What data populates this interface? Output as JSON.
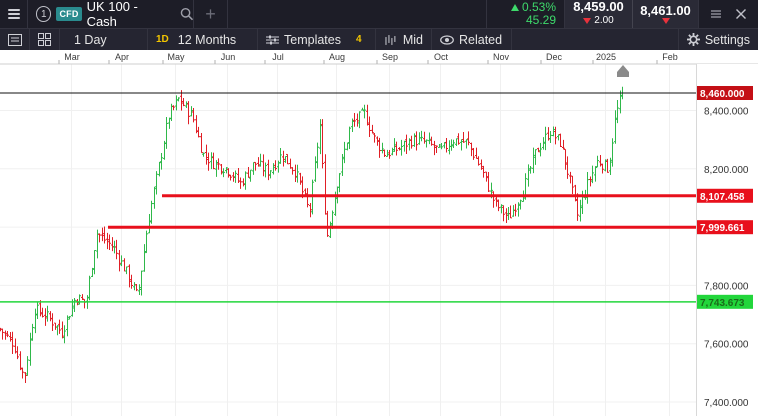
{
  "topbar": {
    "info_number": "1",
    "instrument_type": "CFD",
    "instrument_name": "UK 100 - Cash",
    "change_pct": "0.53%",
    "change_abs": "45.29",
    "sell_price": "8,459.00",
    "spread": "2.00",
    "buy_price": "8,461.00"
  },
  "toolbar": {
    "interval_label": "1 Day",
    "interval_badge": "1D",
    "range_label": "12 Months",
    "templates_label": "Templates",
    "templates_count": "4",
    "price_type_label": "Mid",
    "related_label": "Related",
    "settings_label": "Settings"
  },
  "colors": {
    "up": "#2fb84a",
    "down": "#e01f26",
    "support": "#e8101c",
    "green_level": "#22d63b",
    "current_tag": "#c40f16"
  },
  "chart_data": {
    "type": "ohlc",
    "x_labels": [
      "Mar",
      "Apr",
      "May",
      "Jun",
      "Jul",
      "Aug",
      "Sep",
      "Oct",
      "Nov",
      "Dec",
      "2025",
      "Feb"
    ],
    "y_ticks": [
      7400,
      7600,
      7800,
      8000,
      8200,
      8400
    ],
    "y_tick_labels": [
      "7,400.000",
      "7,600.000",
      "7,800.000",
      "8,000.000",
      "8,200.000",
      "8,400.000"
    ],
    "ylim": [
      7380,
      8500
    ],
    "current_price": 8460,
    "current_price_label": "8,460.000",
    "horizontal_levels": [
      {
        "value": 8107.458,
        "label": "8,107.458",
        "color": "red"
      },
      {
        "value": 7999.661,
        "label": "7,999.661",
        "color": "red"
      },
      {
        "value": 7743.673,
        "label": "7,743.673",
        "color": "green"
      }
    ],
    "close_path": [
      [
        0.0,
        7650
      ],
      [
        0.02,
        7600
      ],
      [
        0.035,
        7480
      ],
      [
        0.05,
        7720
      ],
      [
        0.07,
        7690
      ],
      [
        0.09,
        7640
      ],
      [
        0.11,
        7760
      ],
      [
        0.125,
        7740
      ],
      [
        0.14,
        7980
      ],
      [
        0.165,
        7930
      ],
      [
        0.185,
        7840
      ],
      [
        0.2,
        7760
      ],
      [
        0.215,
        8020
      ],
      [
        0.23,
        8200
      ],
      [
        0.245,
        8380
      ],
      [
        0.26,
        8440
      ],
      [
        0.28,
        8380
      ],
      [
        0.295,
        8250
      ],
      [
        0.31,
        8220
      ],
      [
        0.33,
        8200
      ],
      [
        0.35,
        8150
      ],
      [
        0.37,
        8220
      ],
      [
        0.39,
        8190
      ],
      [
        0.41,
        8250
      ],
      [
        0.43,
        8190
      ],
      [
        0.45,
        8050
      ],
      [
        0.465,
        8350
      ],
      [
        0.475,
        7960
      ],
      [
        0.49,
        8150
      ],
      [
        0.51,
        8350
      ],
      [
        0.53,
        8390
      ],
      [
        0.545,
        8300
      ],
      [
        0.56,
        8250
      ],
      [
        0.58,
        8270
      ],
      [
        0.6,
        8300
      ],
      [
        0.62,
        8290
      ],
      [
        0.64,
        8260
      ],
      [
        0.66,
        8300
      ],
      [
        0.68,
        8290
      ],
      [
        0.7,
        8200
      ],
      [
        0.72,
        8080
      ],
      [
        0.74,
        8030
      ],
      [
        0.76,
        8120
      ],
      [
        0.78,
        8260
      ],
      [
        0.8,
        8330
      ],
      [
        0.815,
        8290
      ],
      [
        0.83,
        8150
      ],
      [
        0.84,
        8040
      ],
      [
        0.855,
        8150
      ],
      [
        0.87,
        8230
      ],
      [
        0.885,
        8200
      ],
      [
        0.895,
        8380
      ],
      [
        0.905,
        8460
      ]
    ]
  }
}
